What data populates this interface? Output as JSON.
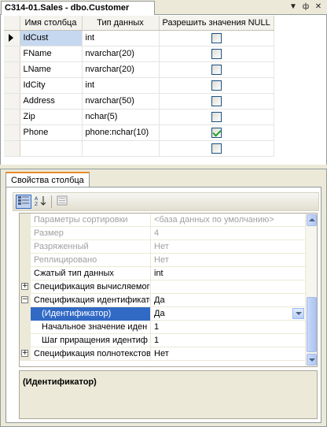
{
  "document_tab": {
    "title": "C314-01.Sales - dbo.Customer"
  },
  "tab_controls": {
    "dropdown_glyph": "▼",
    "pin_glyph": "ф",
    "close_glyph": "✕"
  },
  "columns_grid": {
    "headers": {
      "name": "Имя столбца",
      "type": "Тип данных",
      "null": "Разрешить значения NULL"
    },
    "rows": [
      {
        "name": "IdCust",
        "type": "int",
        "allow_null": false,
        "current": true
      },
      {
        "name": "FName",
        "type": "nvarchar(20)",
        "allow_null": false
      },
      {
        "name": "LName",
        "type": "nvarchar(20)",
        "allow_null": false
      },
      {
        "name": "IdCity",
        "type": "int",
        "allow_null": false
      },
      {
        "name": "Address",
        "type": "nvarchar(50)",
        "allow_null": false
      },
      {
        "name": "Zip",
        "type": "nchar(5)",
        "allow_null": false
      },
      {
        "name": "Phone",
        "type": "phone:nchar(10)",
        "allow_null": true
      },
      {
        "name": "",
        "type": "",
        "allow_null": false
      }
    ]
  },
  "properties_panel": {
    "tab_label": "Свойства столбца",
    "toolbar": {
      "categorized_icon": "categorized-icon",
      "alphabetical_icon": "alphabetical-icon",
      "pages_icon": "property-pages-icon"
    },
    "rows": [
      {
        "name": "Параметры сортировки",
        "value": "<база данных по умолчанию>",
        "disabled": true
      },
      {
        "name": "Размер",
        "value": "4",
        "disabled": true
      },
      {
        "name": "Разряженный",
        "value": "Нет",
        "disabled": true
      },
      {
        "name": "Реплицировано",
        "value": "Нет",
        "disabled": true
      },
      {
        "name": "Сжатый тип данных",
        "value": "int"
      },
      {
        "name": "Спецификация вычисляемого",
        "value": "",
        "expander": "+"
      },
      {
        "name": "Спецификация идентификатора",
        "value": "Да",
        "expander": "−"
      },
      {
        "name": "(Идентификатор)",
        "value": "Да",
        "selected": true,
        "indent": true
      },
      {
        "name": "Начальное значение иден",
        "value": "1",
        "indent": true
      },
      {
        "name": "Шаг приращения идентиф",
        "value": "1",
        "indent": true
      },
      {
        "name": "Спецификация полнотекстов",
        "value": "Нет",
        "expander": "+"
      }
    ],
    "description_title": "(Идентификатор)"
  }
}
